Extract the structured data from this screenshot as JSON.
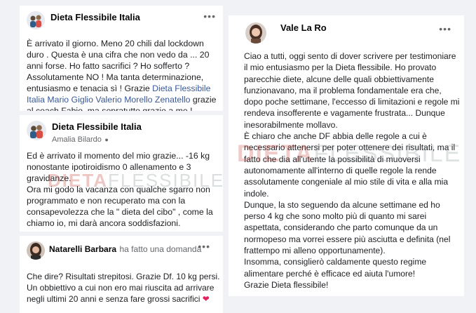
{
  "post1": {
    "author": "Dieta Flessibile Italia",
    "more_icon": "more-horizontal-icon",
    "text_before": "È arrivato il giorno. Meno 20 chili dal lockdown duro . Questa è una cifra che non vedo da ... 20 anni forse. Ho fatto sacrifici ? Ho sofferto ? Assolutamente NO ! Ma tanta determinazione, entusiasmo e tenacia sì ! Grazie ",
    "mention": "Dieta Flessibile Italia Mario Giglio Valerio Morello Zenatello",
    "text_after": " grazie al coach Fabio, ma sopratutto grazie a me !"
  },
  "post2": {
    "author": "Dieta Flessibile Italia",
    "sub_author": "Amalia Bilardo",
    "more_icon": "more-horizontal-icon",
    "text": "Ed è arrivato il momento del mio grazie... -16 kg nonostante ipotiroidismo 0 allenamento e 3 gravidanze.\nOra mi godo la vacanza con qualche sgarro non programmato e non recuperato ma con la consapevolezza che la \" dieta del cibo\" , come la chiamo io, mi darà ancora soddisfazioni."
  },
  "post3": {
    "author": "Natarelli Barbara",
    "action": "ha fatto una domanda",
    "more_icon": "more-horizontal-icon",
    "text": "Che dire? Risultati strepitosi. Grazie Df. 10 kg persi. Un obbiettivo a cui non ero mai riuscita ad arrivare negli ultimi 20 anni e senza fare grossi sacrifici",
    "heart_icon": "red-heart-icon"
  },
  "post4": {
    "author": "Vale La Ro",
    "more_icon": "more-horizontal-icon",
    "paragraphs": [
      "Ciao a tutti, oggi sento di dover scrivere per testimoniare il mio entusiasmo per la Dieta flessibile. Ho provato parecchie diete, alcune delle quali obbiettivamente funzionavano, ma il problema fondamentale era che, dopo poche settimane, l'eccesso di limitazioni e regole mi rendeva insofferente e vagamente frustrata... Dunque inesorabilmente mollavo.",
      "È chiaro che anche DF abbia delle regole a cui è necessario attenersi per poter ottenere dei risultati, ma il fatto che dia all'utente la possibilità di muoversi autonomamente all'interno di quelle regole la rende assolutamente congeniale al mio stile di vita e alla mia indole.",
      "Dunque, la sto seguendo da alcune settimane ed ho perso 4 kg che sono molto più di quanto mi sarei aspettata, considerando che parto comunque da un normopeso ma vorrei essere più asciutta e definita (nel frattempo mi alleno opportunamente).",
      "Insomma, consiglierò caldamente questo regime alimentare perché è efficace ed aiuta l'umore!",
      "Grazie Dieta flessibile!"
    ]
  },
  "watermark": {
    "left": "DIETA",
    "right": "FLESSIBILE"
  },
  "colors": {
    "background": "#f0f2f5",
    "card": "#ffffff",
    "link": "#385898",
    "watermark_red": "#c0392b"
  }
}
